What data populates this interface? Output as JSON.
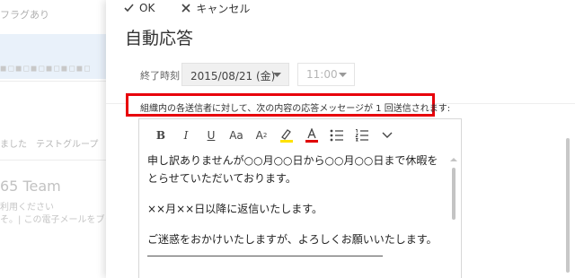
{
  "background": {
    "filter_label": "フラグあり",
    "dots": "◼◻◼◻◼◻◼◻◼◻◼◻",
    "msg_fragment": "ました　テストグループ　グルー",
    "team_fragment": "65 Team",
    "line1": "利用ください",
    "line2": "そ。| この電子メールをブラウ"
  },
  "command_bar": {
    "ok_label": "OK",
    "cancel_label": "キャンセル"
  },
  "title": "自動応答",
  "end_time": {
    "label": "終了時刻",
    "date_value": "2015/08/21 (金)",
    "time_value": "11:00"
  },
  "notice": "組織内の各送信者に対して、次の内容の応答メッセージが 1 回送信されます:",
  "toolbar": {
    "bold": "B",
    "italic": "I",
    "underline": "U",
    "font_size": "Aa",
    "superscript": "A",
    "superscript_mark": "2"
  },
  "body": {
    "line1": "申し訳ありませんが○○月○○日から○○月○○日まで休暇をとらせていただいております。",
    "line2": "××月××日以降に返信いたします。",
    "line3": "ご迷惑をおかけいたしますが、よろしくお願いいたします。"
  },
  "colors": {
    "notice_border": "#e8000b",
    "selected_row": "#e9f1fa",
    "font_color_bar": "#e00000",
    "highlight_bar": "#ffe200"
  }
}
